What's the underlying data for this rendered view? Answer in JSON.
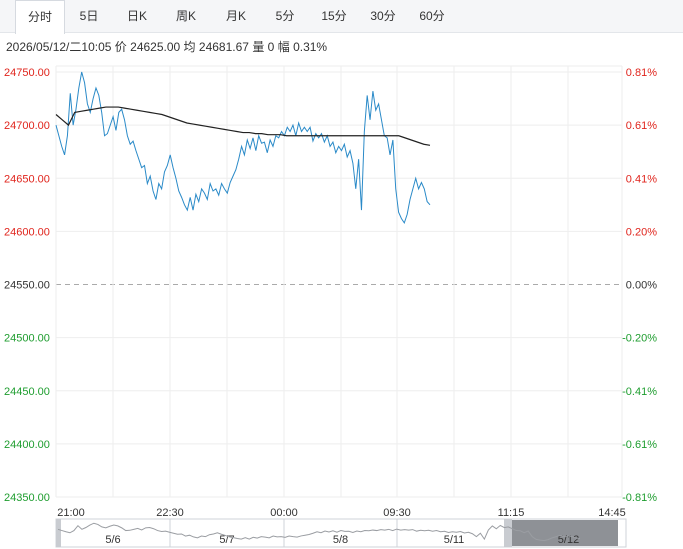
{
  "tabs": [
    {
      "label": "分时",
      "active": true
    },
    {
      "label": "5日",
      "active": false
    },
    {
      "label": "日K",
      "active": false
    },
    {
      "label": "周K",
      "active": false
    },
    {
      "label": "月K",
      "active": false
    },
    {
      "label": "5分",
      "active": false
    },
    {
      "label": "15分",
      "active": false
    },
    {
      "label": "30分",
      "active": false
    },
    {
      "label": "60分",
      "active": false
    }
  ],
  "info": {
    "datetime": "2026/05/12/二10:05",
    "price_label": "价",
    "price": "24625.00",
    "avg_label": "均",
    "avg": "24681.67",
    "vol_label": "量",
    "vol": "0",
    "change_label": "幅",
    "change": "0.31%"
  },
  "colors": {
    "up": "#e0251d",
    "down": "#1e9d2f",
    "neutral": "#333333",
    "price_line": "#2a8ac8",
    "avg_line": "#222222",
    "grid": "#eeeeee"
  },
  "chart_data": {
    "type": "line",
    "base": 24550,
    "ylim": [
      24350,
      24750
    ],
    "y_ticks": [
      "24750.00",
      "24700.00",
      "24650.00",
      "24600.00",
      "24550.00",
      "24500.00",
      "24450.00",
      "24400.00",
      "24350.00"
    ],
    "pct_ticks": [
      "0.81%",
      "0.61%",
      "0.41%",
      "0.20%",
      "0.00%",
      "-0.20%",
      "-0.41%",
      "-0.61%",
      "-0.81%"
    ],
    "x_ticks": [
      "21:00",
      "22:30",
      "00:00",
      "09:30",
      "11:15",
      "14:45"
    ],
    "nav_days": [
      "5/6",
      "5/7",
      "5/8",
      "5/11",
      "5/12"
    ],
    "series": [
      {
        "values": [
          24700,
          24690,
          24680,
          24672,
          24690,
          24730,
          24700,
          24715,
          24735,
          24750,
          24740,
          24720,
          24712,
          24725,
          24735,
          24728,
          24712,
          24690,
          24692,
          24700,
          24708,
          24695,
          24712,
          24715,
          24705,
          24690,
          24682,
          24685,
          24676,
          24668,
          24660,
          24662,
          24645,
          24652,
          24638,
          24630,
          24645,
          24640,
          24656,
          24662,
          24672,
          24660,
          24650,
          24638,
          24632,
          24625,
          24620,
          24632,
          24620,
          24635,
          24628,
          24640,
          24636,
          24630,
          24645,
          24638,
          24640,
          24634,
          24645,
          24640,
          24636,
          24646,
          24652,
          24658,
          24668,
          24680,
          24672,
          24686,
          24678,
          24688,
          24676,
          24690,
          24683,
          24684,
          24674,
          24686,
          24680,
          24690,
          24688,
          24694,
          24690,
          24698,
          24694,
          24700,
          24690,
          24702,
          24694,
          24698,
          24694,
          24698,
          24685,
          24692,
          24688,
          24692,
          24684,
          24690,
          24680,
          24684,
          24674,
          24680,
          24676,
          24682,
          24670,
          24676,
          24664,
          24640,
          24668,
          24620,
          24694,
          24728,
          24705,
          24732,
          24714,
          24720,
          24705,
          24690,
          24688,
          24672,
          24686,
          24640,
          24618,
          24612,
          24608,
          24616,
          24630,
          24640,
          24650,
          24640,
          24646,
          24640,
          24628,
          24625
        ]
      },
      {
        "values": [
          24710,
          24705,
          24700,
          24712,
          24713,
          24714,
          24715,
          24716,
          24717,
          24717,
          24717,
          24716,
          24715,
          24714,
          24713,
          24712,
          24711,
          24710,
          24708,
          24706,
          24704,
          24702,
          24701,
          24700,
          24699,
          24698,
          24697,
          24696,
          24695,
          24694,
          24693,
          24693,
          24692,
          24692,
          24691,
          24691,
          24691,
          24690,
          24690,
          24690,
          24690,
          24690,
          24690,
          24690,
          24690,
          24690,
          24690,
          24690,
          24690,
          24690,
          24690,
          24690,
          24690,
          24690,
          24690,
          24690,
          24688,
          24686,
          24684,
          24682,
          24681
        ]
      }
    ]
  }
}
